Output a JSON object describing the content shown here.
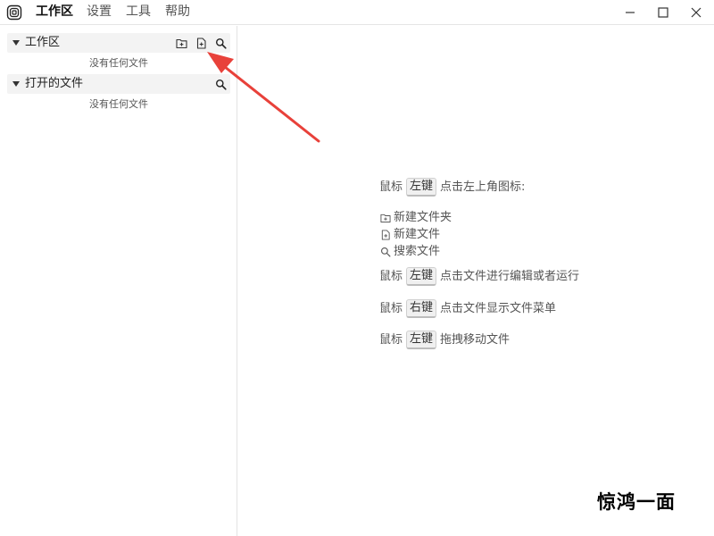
{
  "titlebar": {
    "menu": [
      {
        "label": "工作区",
        "active": true
      },
      {
        "label": "设置",
        "active": false
      },
      {
        "label": "工具",
        "active": false
      },
      {
        "label": "帮助",
        "active": false
      }
    ]
  },
  "sidebar": {
    "workspace": {
      "title": "工作区",
      "empty_text": "没有任何文件",
      "icons": [
        "new-folder-icon",
        "new-file-icon",
        "search-icon"
      ]
    },
    "open_files": {
      "title": "打开的文件",
      "empty_text": "没有任何文件",
      "icons": [
        "search-icon"
      ]
    }
  },
  "main": {
    "hint1": {
      "prefix": "鼠标",
      "key": "左键",
      "suffix": "点击左上角图标:"
    },
    "features": [
      {
        "icon": "new-folder-icon",
        "label": "新建文件夹"
      },
      {
        "icon": "new-file-icon",
        "label": "新建文件"
      },
      {
        "icon": "search-icon",
        "label": "搜索文件"
      }
    ],
    "hint2": {
      "prefix": "鼠标",
      "key": "左键",
      "suffix": "点击文件进行编辑或者运行"
    },
    "hint3": {
      "prefix": "鼠标",
      "key": "右键",
      "suffix": "点击文件显示文件菜单"
    },
    "hint4": {
      "prefix": "鼠标",
      "key": "左键",
      "suffix": "拖拽移动文件"
    }
  },
  "watermark": "惊鸿一面",
  "colors": {
    "arrow": "#e8413a",
    "header_bg": "#f3f3f3",
    "divider": "#e3e3e3"
  }
}
